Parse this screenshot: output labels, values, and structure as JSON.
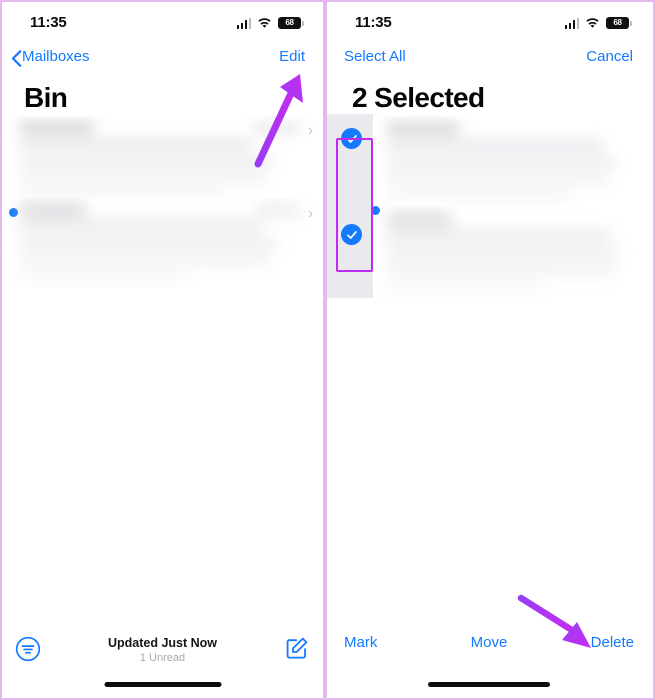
{
  "meta": {
    "title": "iPhone Mail app — Bin mailbox, Edit mode selection",
    "accent_blue": "#1479ff",
    "annotation_purple": "#c02af5",
    "frame_border": "#e5b8f0"
  },
  "left_panel": {
    "status_bar": {
      "time": "11:35",
      "cellular_icon": "cellular-signal-icon",
      "wifi_icon": "wifi-icon",
      "battery_icon": "battery-icon",
      "battery_level": "68"
    },
    "nav_bar": {
      "back_icon": "chevron-left-icon",
      "back_label": "Mailboxes",
      "action_label": "Edit"
    },
    "page_title": "Bin",
    "mail_list": {
      "rows": [
        {
          "redacted": true,
          "unread": false,
          "disclosure_icon": "chevron-right-icon"
        },
        {
          "redacted": true,
          "unread": true,
          "disclosure_icon": "chevron-right-icon"
        }
      ]
    },
    "toolbar": {
      "filter_icon": "filter-icon",
      "status_primary": "Updated Just Now",
      "status_secondary": "1 Unread",
      "compose_icon": "compose-icon"
    },
    "home_indicator": "home-indicator"
  },
  "right_panel": {
    "status_bar": {
      "time": "11:35",
      "cellular_icon": "cellular-signal-icon",
      "wifi_icon": "wifi-icon",
      "battery_icon": "battery-icon",
      "battery_level": "68"
    },
    "nav_bar": {
      "left_action_label": "Select All",
      "right_action_label": "Cancel"
    },
    "page_title": "2 Selected",
    "mail_list": {
      "rows": [
        {
          "redacted": true,
          "selected": true,
          "checkbox_icon": "checkmark-circle-filled-icon"
        },
        {
          "redacted": true,
          "selected": true,
          "checkbox_icon": "checkmark-circle-filled-icon"
        }
      ]
    },
    "toolbar": {
      "mark_label": "Mark",
      "move_label": "Move",
      "delete_label": "Delete"
    },
    "home_indicator": "home-indicator"
  },
  "annotations": [
    {
      "id": "arrow-to-edit",
      "type": "arrow",
      "target": "Edit"
    },
    {
      "id": "highlight-checkboxes",
      "type": "rectangle",
      "target": "selection checkboxes"
    },
    {
      "id": "arrow-to-delete",
      "type": "arrow",
      "target": "Delete"
    }
  ]
}
